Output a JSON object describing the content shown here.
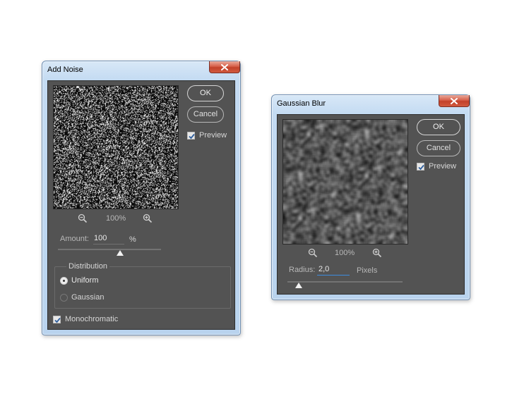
{
  "add_noise": {
    "title": "Add Noise",
    "ok_label": "OK",
    "cancel_label": "Cancel",
    "preview_label": "Preview",
    "preview_checked": true,
    "zoom_level": "100%",
    "amount_label": "Amount:",
    "amount_value": "100",
    "amount_unit": "%",
    "amount_slider_fraction": 0.6,
    "distribution_label": "Distribution",
    "distribution_options": [
      "Uniform",
      "Gaussian"
    ],
    "distribution_selected": "Uniform",
    "monochromatic_label": "Monochromatic",
    "monochromatic_checked": true
  },
  "gaussian_blur": {
    "title": "Gaussian Blur",
    "ok_label": "OK",
    "cancel_label": "Cancel",
    "preview_label": "Preview",
    "preview_checked": true,
    "zoom_level": "100%",
    "radius_label": "Radius:",
    "radius_value": "2,0",
    "radius_unit": "Pixels",
    "radius_slider_fraction": 0.1
  },
  "icons": {
    "close": "close-icon",
    "zoom_out": "zoom-out-icon",
    "zoom_in": "zoom-in-icon",
    "check": "checkmark-icon"
  },
  "colors": {
    "panel_bg": "#535353",
    "frame": "#c4dbf2",
    "close_red": "#c2412a",
    "checkbox_accent": "#2f5f9e"
  }
}
